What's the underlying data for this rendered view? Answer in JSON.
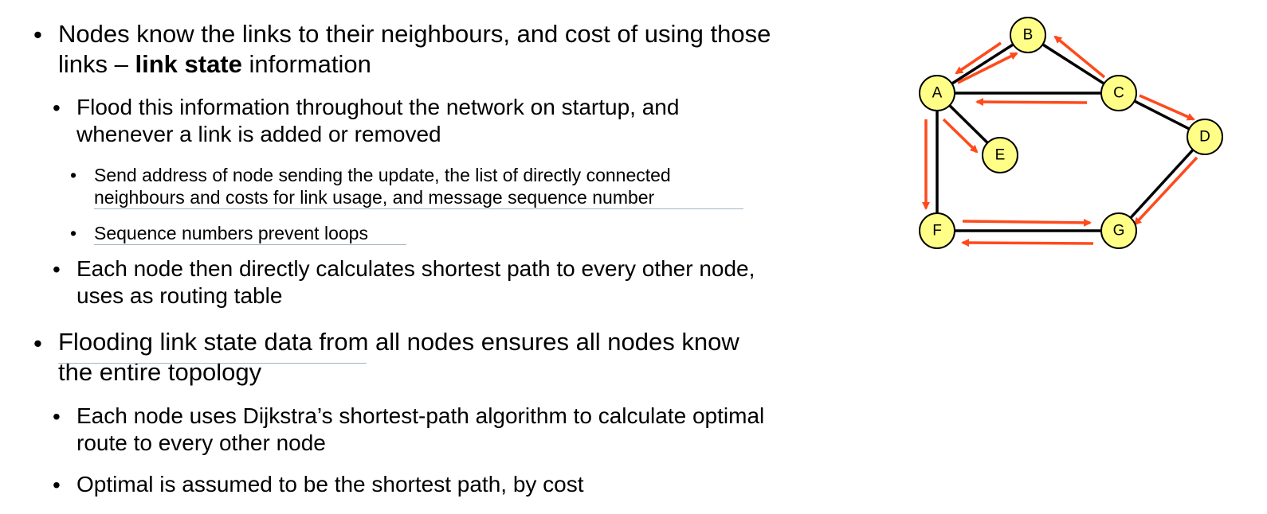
{
  "bullets": {
    "b1": {
      "pre": "Nodes know the links to their neighbours, and cost of using those links – ",
      "bold": "link state",
      "post": " information"
    },
    "b1_1": "Flood this information throughout the network on startup, and whenever a link is added or removed",
    "b1_1_1": "Send address of node sending the update, the list of directly connected neighbours and costs for link usage, and message sequence number",
    "b1_1_2": "Sequence numbers prevent loops",
    "b1_2": "Each node then directly calculates shortest path to every other node, uses as routing table",
    "b2": "Flooding link state data from all nodes ensures all nodes know the entire topology",
    "b2_1": "Each node uses Dijkstra’s shortest-path algorithm to calculate optimal route to every other node",
    "b2_2": "Optimal is assumed to be the shortest path, by cost"
  },
  "graph": {
    "nodes": [
      "A",
      "B",
      "C",
      "D",
      "E",
      "F",
      "G"
    ],
    "edges": [
      [
        "A",
        "B"
      ],
      [
        "B",
        "C"
      ],
      [
        "A",
        "C"
      ],
      [
        "A",
        "E"
      ],
      [
        "A",
        "F"
      ],
      [
        "C",
        "D"
      ],
      [
        "D",
        "G"
      ],
      [
        "F",
        "G"
      ]
    ],
    "colors": {
      "node_fill": "#ffff88",
      "node_stroke": "#000000",
      "edge": "#000000",
      "arrow": "#ff4a1c"
    }
  }
}
